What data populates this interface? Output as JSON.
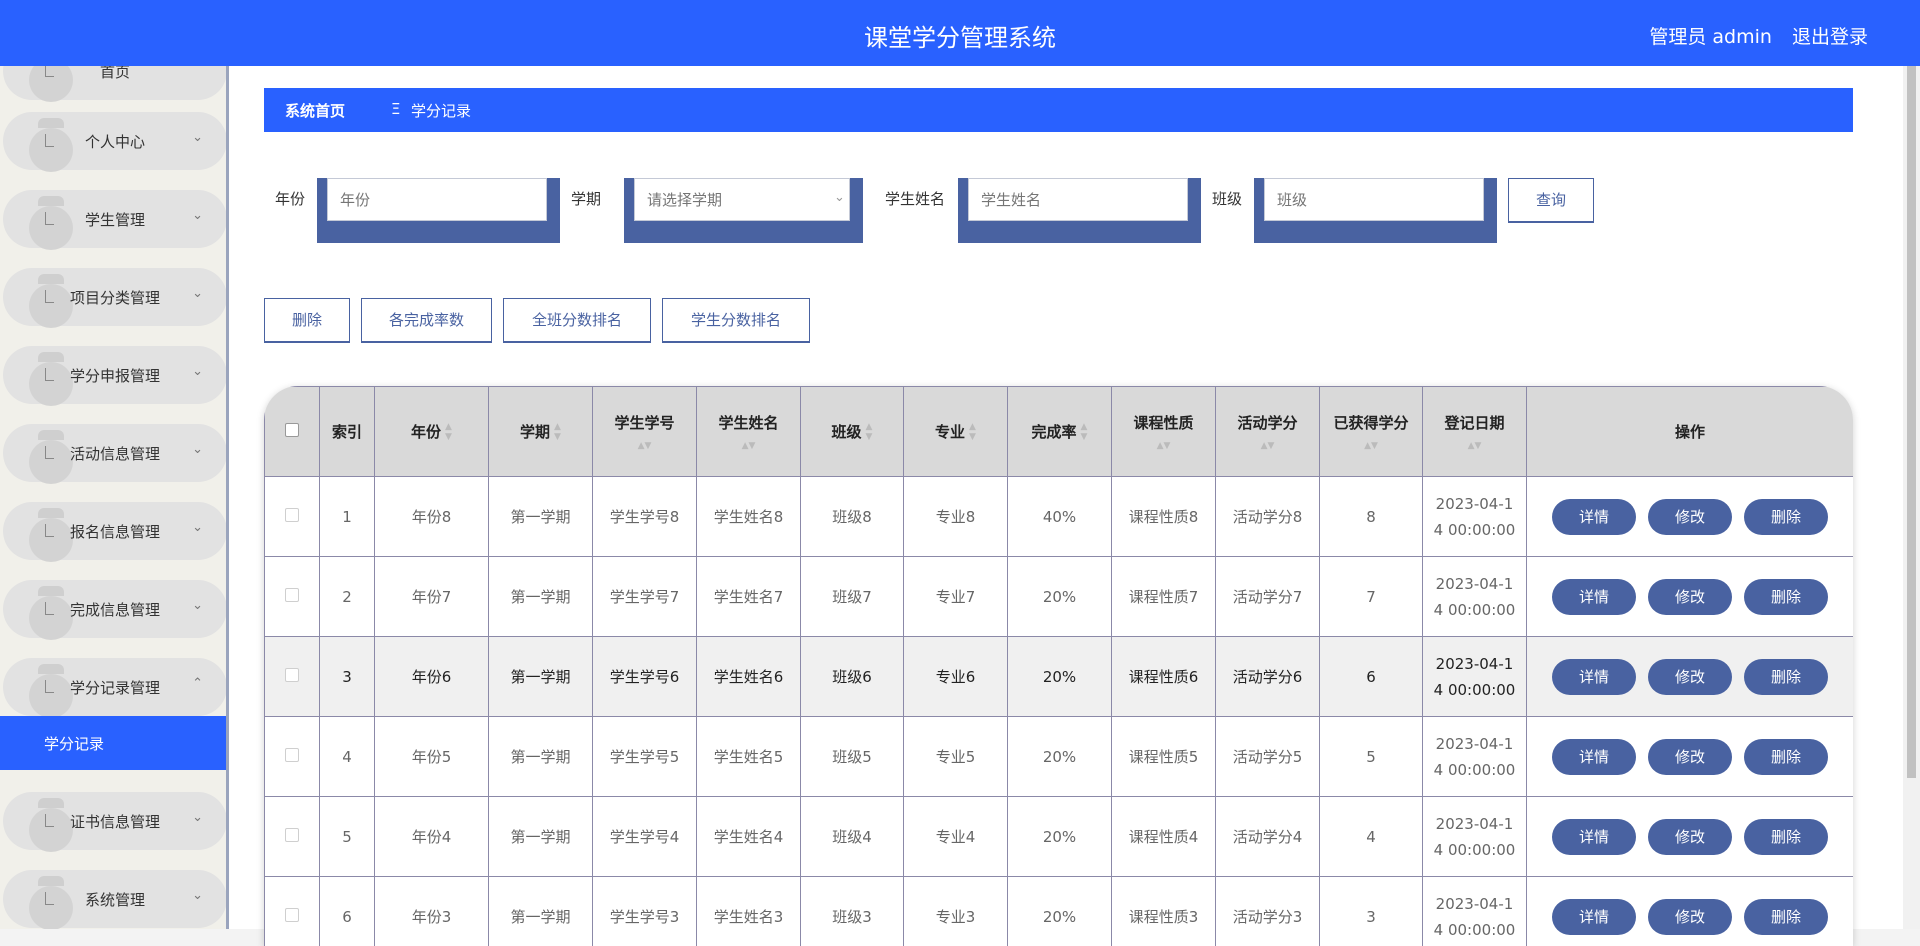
{
  "header": {
    "title": "课堂学分管理系统",
    "user_label": "管理员 admin",
    "logout": "退出登录"
  },
  "sidebar": {
    "items": [
      {
        "label": "首页",
        "chevron": ""
      },
      {
        "label": "个人中心",
        "chevron": "⌄"
      },
      {
        "label": "学生管理",
        "chevron": "⌄"
      },
      {
        "label": "项目分类管理",
        "chevron": "⌄"
      },
      {
        "label": "学分申报管理",
        "chevron": "⌄"
      },
      {
        "label": "活动信息管理",
        "chevron": "⌄"
      },
      {
        "label": "报名信息管理",
        "chevron": "⌄"
      },
      {
        "label": "完成信息管理",
        "chevron": "⌄"
      },
      {
        "label": "学分记录管理",
        "chevron": "⌃"
      },
      {
        "label": "证书信息管理",
        "chevron": "⌄"
      },
      {
        "label": "系统管理",
        "chevron": "⌄"
      }
    ],
    "active_sub": "学分记录"
  },
  "breadcrumb": {
    "home": "系统首页",
    "sep": "Ξ",
    "current": "学分记录"
  },
  "filters": {
    "year_label": "年份",
    "year_placeholder": "年份",
    "term_label": "学期",
    "term_placeholder": "请选择学期",
    "name_label": "学生姓名",
    "name_placeholder": "学生姓名",
    "class_label": "班级",
    "class_placeholder": "班级",
    "query": "查询"
  },
  "actions": {
    "delete": "删除",
    "completion": "各完成率数",
    "class_rank": "全班分数排名",
    "student_rank": "学生分数排名"
  },
  "table": {
    "columns": [
      "索引",
      "年份",
      "学期",
      "学生学号",
      "学生姓名",
      "班级",
      "专业",
      "完成率",
      "课程性质",
      "活动学分",
      "已获得学分",
      "登记日期",
      "操作"
    ],
    "rows": [
      {
        "idx": "1",
        "year": "年份8",
        "term": "第一学期",
        "sno": "学生学号8",
        "sname": "学生姓名8",
        "cls": "班级8",
        "major": "专业8",
        "rate": "40%",
        "nature": "课程性质8",
        "act": "活动学分8",
        "earned": "8",
        "date1": "2023-04-1",
        "date2": "4 00:00:00"
      },
      {
        "idx": "2",
        "year": "年份7",
        "term": "第一学期",
        "sno": "学生学号7",
        "sname": "学生姓名7",
        "cls": "班级7",
        "major": "专业7",
        "rate": "20%",
        "nature": "课程性质7",
        "act": "活动学分7",
        "earned": "7",
        "date1": "2023-04-1",
        "date2": "4 00:00:00"
      },
      {
        "idx": "3",
        "year": "年份6",
        "term": "第一学期",
        "sno": "学生学号6",
        "sname": "学生姓名6",
        "cls": "班级6",
        "major": "专业6",
        "rate": "20%",
        "nature": "课程性质6",
        "act": "活动学分6",
        "earned": "6",
        "date1": "2023-04-1",
        "date2": "4 00:00:00"
      },
      {
        "idx": "4",
        "year": "年份5",
        "term": "第一学期",
        "sno": "学生学号5",
        "sname": "学生姓名5",
        "cls": "班级5",
        "major": "专业5",
        "rate": "20%",
        "nature": "课程性质5",
        "act": "活动学分5",
        "earned": "5",
        "date1": "2023-04-1",
        "date2": "4 00:00:00"
      },
      {
        "idx": "5",
        "year": "年份4",
        "term": "第一学期",
        "sno": "学生学号4",
        "sname": "学生姓名4",
        "cls": "班级4",
        "major": "专业4",
        "rate": "20%",
        "nature": "课程性质4",
        "act": "活动学分4",
        "earned": "4",
        "date1": "2023-04-1",
        "date2": "4 00:00:00"
      },
      {
        "idx": "6",
        "year": "年份3",
        "term": "第一学期",
        "sno": "学生学号3",
        "sname": "学生姓名3",
        "cls": "班级3",
        "major": "专业3",
        "rate": "20%",
        "nature": "课程性质3",
        "act": "活动学分3",
        "earned": "3",
        "date1": "2023-04-1",
        "date2": "4 00:00:00"
      }
    ],
    "op_detail": "详情",
    "op_edit": "修改",
    "op_delete": "删除"
  },
  "colors": {
    "brand": "#2961ff",
    "button": "#4962a1"
  }
}
